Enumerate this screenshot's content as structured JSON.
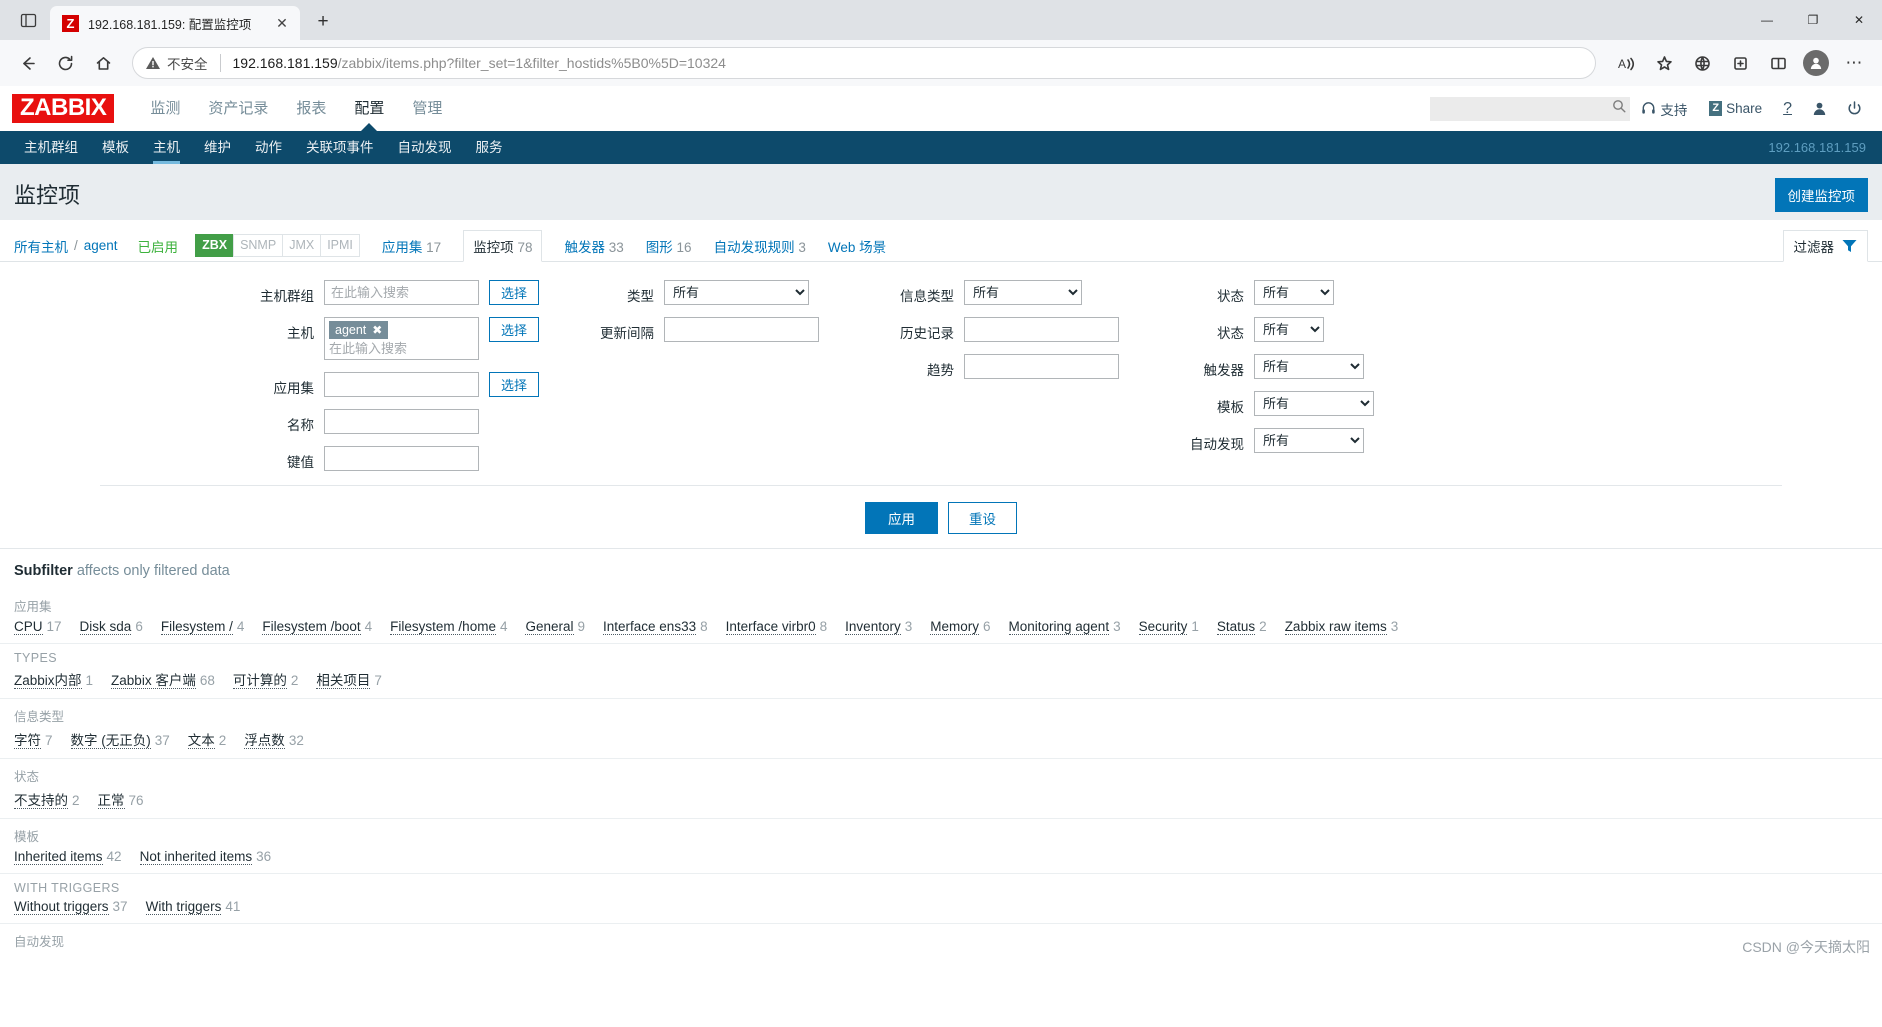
{
  "browser": {
    "tab": {
      "title": "192.168.181.159: 配置监控项",
      "favicon_letter": "Z",
      "close_label": "✕"
    },
    "new_tab_label": "+",
    "window_controls": {
      "minimize": "—",
      "maximize": "❐",
      "close": "✕",
      "more": "⋯"
    },
    "omnibox": {
      "warning_label": "不安全",
      "url_host": "192.168.181.159",
      "url_path": "/zabbix/items.php?filter_set=1&filter_hostids%5B0%5D=10324"
    },
    "icons": {
      "tab_list": "tab-list-icon",
      "back": "back-arrow-icon",
      "reload": "reload-icon",
      "home": "home-icon",
      "warning": "warning-triangle-icon",
      "read_aloud": "read-aloud-icon",
      "favorite": "favorite-star-icon",
      "browser_essentials": "browser-essentials-icon",
      "collections": "collections-icon",
      "split_screen": "split-screen-icon",
      "profile": "profile-avatar-icon",
      "settings_more": "settings-more-icon"
    }
  },
  "zabbix": {
    "logo": "ZABBIX",
    "main_nav": [
      {
        "label": "监测",
        "active": false
      },
      {
        "label": "资产记录",
        "active": false
      },
      {
        "label": "报表",
        "active": false
      },
      {
        "label": "配置",
        "active": true
      },
      {
        "label": "管理",
        "active": false
      }
    ],
    "header_right": {
      "search_placeholder": "",
      "search_value": "",
      "support_label": "支持",
      "share_label": "Share",
      "share_badge": "Z",
      "help_label": "?",
      "user_icon": "user-icon",
      "signout_icon": "power-signout-icon"
    },
    "sub_nav": [
      {
        "label": "主机群组",
        "active": false
      },
      {
        "label": "模板",
        "active": false
      },
      {
        "label": "主机",
        "active": true
      },
      {
        "label": "维护",
        "active": false
      },
      {
        "label": "动作",
        "active": false
      },
      {
        "label": "关联项事件",
        "active": false
      },
      {
        "label": "自动发现",
        "active": false
      },
      {
        "label": "服务",
        "active": false
      }
    ],
    "server_ip": "192.168.181.159"
  },
  "page": {
    "title": "监控项",
    "create_button": "创建监控项"
  },
  "tabs_row": {
    "breadcrumb_all_hosts": "所有主机",
    "breadcrumb_sep": "/",
    "breadcrumb_host": "agent",
    "enabled_label": "已启用",
    "protocols": [
      {
        "label": "ZBX",
        "on": true
      },
      {
        "label": "SNMP",
        "on": false
      },
      {
        "label": "JMX",
        "on": false
      },
      {
        "label": "IPMI",
        "on": false
      }
    ],
    "links": [
      {
        "label": "应用集",
        "count": "17",
        "selected": false
      },
      {
        "label": "监控项",
        "count": "78",
        "selected": true
      },
      {
        "label": "触发器",
        "count": "33",
        "selected": false
      },
      {
        "label": "图形",
        "count": "16",
        "selected": false
      },
      {
        "label": "自动发现规则",
        "count": "3",
        "selected": false
      },
      {
        "label": "Web 场景",
        "count": "",
        "selected": false
      }
    ],
    "filter_tab_label": "过滤器"
  },
  "filter": {
    "col1": {
      "host_group_label": "主机群组",
      "host_group_placeholder": "在此输入搜索",
      "host_group_value": "",
      "host_group_select": "选择",
      "host_label": "主机",
      "host_chip": "agent",
      "host_chip_remove": "✖",
      "host_placeholder": "在此输入搜索",
      "host_select": "选择",
      "appset_label": "应用集",
      "appset_value": "",
      "appset_select": "选择",
      "name_label": "名称",
      "name_value": "",
      "key_label": "键值",
      "key_value": ""
    },
    "col2": {
      "type_label": "类型",
      "type_value": "所有",
      "type_options": [
        "所有"
      ],
      "interval_label": "更新间隔",
      "interval_value": ""
    },
    "col3": {
      "info_type_label": "信息类型",
      "info_type_value": "所有",
      "info_type_options": [
        "所有"
      ],
      "history_label": "历史记录",
      "history_value": "",
      "trends_label": "趋势",
      "trends_value": ""
    },
    "col4": {
      "state_label": "状态",
      "state_value": "所有",
      "state_options": [
        "所有"
      ],
      "status_label": "状态",
      "status_value": "所有",
      "status_options": [
        "所有"
      ],
      "triggers_label": "触发器",
      "triggers_value": "所有",
      "triggers_options": [
        "所有"
      ],
      "template_label": "模板",
      "template_value": "所有",
      "template_options": [
        "所有"
      ],
      "discovery_label": "自动发现",
      "discovery_value": "所有",
      "discovery_options": [
        "所有"
      ]
    },
    "apply_label": "应用",
    "reset_label": "重设"
  },
  "subfilter": {
    "title_bold": "Subfilter",
    "title_rest": " affects only filtered data",
    "blocks": [
      {
        "heading": "应用集",
        "caps": false,
        "items": [
          {
            "label": "CPU",
            "count": "17"
          },
          {
            "label": "Disk sda",
            "count": "6"
          },
          {
            "label": "Filesystem /",
            "count": "4"
          },
          {
            "label": "Filesystem /boot",
            "count": "4"
          },
          {
            "label": "Filesystem /home",
            "count": "4"
          },
          {
            "label": "General",
            "count": "9"
          },
          {
            "label": "Interface ens33",
            "count": "8"
          },
          {
            "label": "Interface virbr0",
            "count": "8"
          },
          {
            "label": "Inventory",
            "count": "3"
          },
          {
            "label": "Memory",
            "count": "6"
          },
          {
            "label": "Monitoring agent",
            "count": "3"
          },
          {
            "label": "Security",
            "count": "1"
          },
          {
            "label": "Status",
            "count": "2"
          },
          {
            "label": "Zabbix raw items",
            "count": "3"
          }
        ]
      },
      {
        "heading": "TYPES",
        "caps": true,
        "items": [
          {
            "label": "Zabbix内部",
            "count": "1"
          },
          {
            "label": "Zabbix 客户端",
            "count": "68"
          },
          {
            "label": "可计算的",
            "count": "2"
          },
          {
            "label": "相关项目",
            "count": "7"
          }
        ]
      },
      {
        "heading": "信息类型",
        "caps": false,
        "items": [
          {
            "label": "字符",
            "count": "7"
          },
          {
            "label": "数字 (无正负)",
            "count": "37"
          },
          {
            "label": "文本",
            "count": "2"
          },
          {
            "label": "浮点数",
            "count": "32"
          }
        ]
      },
      {
        "heading": "状态",
        "caps": false,
        "items": [
          {
            "label": "不支持的",
            "count": "2"
          },
          {
            "label": "正常",
            "count": "76"
          }
        ]
      },
      {
        "heading": "模板",
        "caps": false,
        "items": [
          {
            "label": "Inherited items",
            "count": "42"
          },
          {
            "label": "Not inherited items",
            "count": "36"
          }
        ]
      },
      {
        "heading": "WITH TRIGGERS",
        "caps": true,
        "items": [
          {
            "label": "Without triggers",
            "count": "37"
          },
          {
            "label": "With triggers",
            "count": "41"
          }
        ]
      },
      {
        "heading": "自动发现",
        "caps": false,
        "items": []
      }
    ]
  },
  "watermark": "CSDN @今天摘太阳"
}
